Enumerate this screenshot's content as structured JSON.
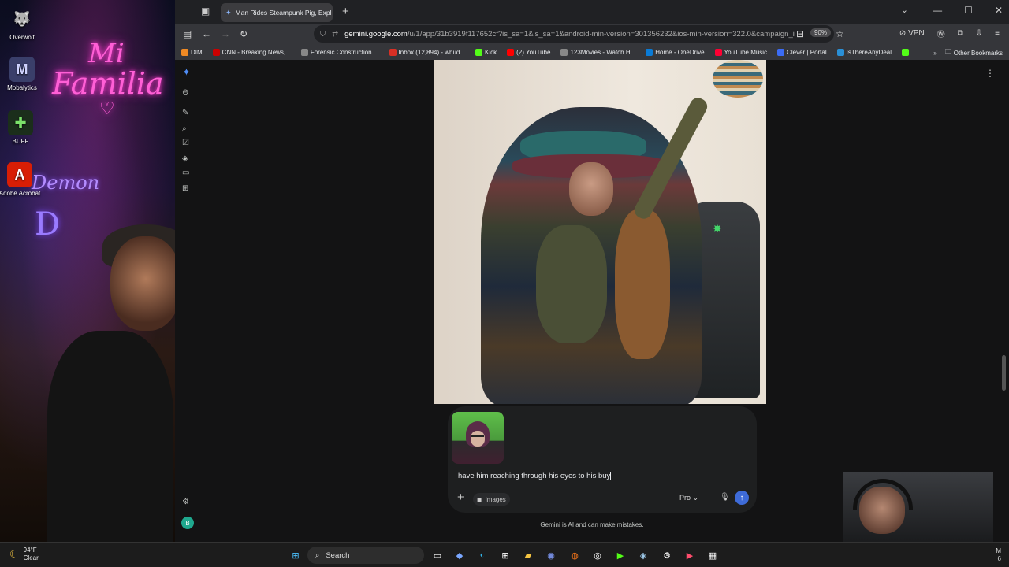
{
  "desktop": {
    "neon_line1": "Mi",
    "neon_line2": "Familia",
    "neon_heart": "♡",
    "neon_demon": "Demon",
    "neon_d": "D",
    "icons": [
      {
        "label": "Overwolf"
      },
      {
        "label": "Mobalytics"
      },
      {
        "label": "BUFF"
      },
      {
        "label": "Adobe Acrobat"
      }
    ]
  },
  "browser": {
    "tab_title": "Man Rides Steampunk Pig, Expl",
    "url_host": "gemini.google.com",
    "url_path": "/u/1/app/31b3919f117652cf?is_sa=1&is_sa=1&android-min-version=301356232&ios-min-version=322.0&campaign_i",
    "zoom": "90%",
    "vpn_label": "VPN",
    "bookmarks": [
      {
        "label": "DIM",
        "color": "#f08a24"
      },
      {
        "label": "CNN - Breaking News,...",
        "color": "#cc0000"
      },
      {
        "label": "Forensic Construction ...",
        "color": "#888888"
      },
      {
        "label": "Inbox (12,894) - whud...",
        "color": "#d93025"
      },
      {
        "label": "Kick",
        "color": "#53fc18"
      },
      {
        "label": "(2) YouTube",
        "color": "#ff0000"
      },
      {
        "label": "123Movies - Watch H...",
        "color": "#888888"
      },
      {
        "label": "Home - OneDrive",
        "color": "#0a7bd6"
      },
      {
        "label": "YouTube Music",
        "color": "#ff0033"
      },
      {
        "label": "Clever | Portal",
        "color": "#3b6cf5"
      },
      {
        "label": "IsThereAnyDeal",
        "color": "#2a8fd6"
      }
    ],
    "other_bookmarks": "Other Bookmarks"
  },
  "gemini": {
    "prompt_text": "have him reaching through his eyes to his buy",
    "images_chip": "Images",
    "model_label": "Pro",
    "disclaimer": "Gemini is AI and can make mistakes.",
    "avatar_letter": "B",
    "colors": {
      "accent": "#3e6bd8",
      "background": "#131314"
    }
  },
  "taskbar": {
    "temp": "94°F",
    "condition": "Clear",
    "search_label": "Search",
    "tray_line1": "M",
    "tray_line2": "6"
  }
}
